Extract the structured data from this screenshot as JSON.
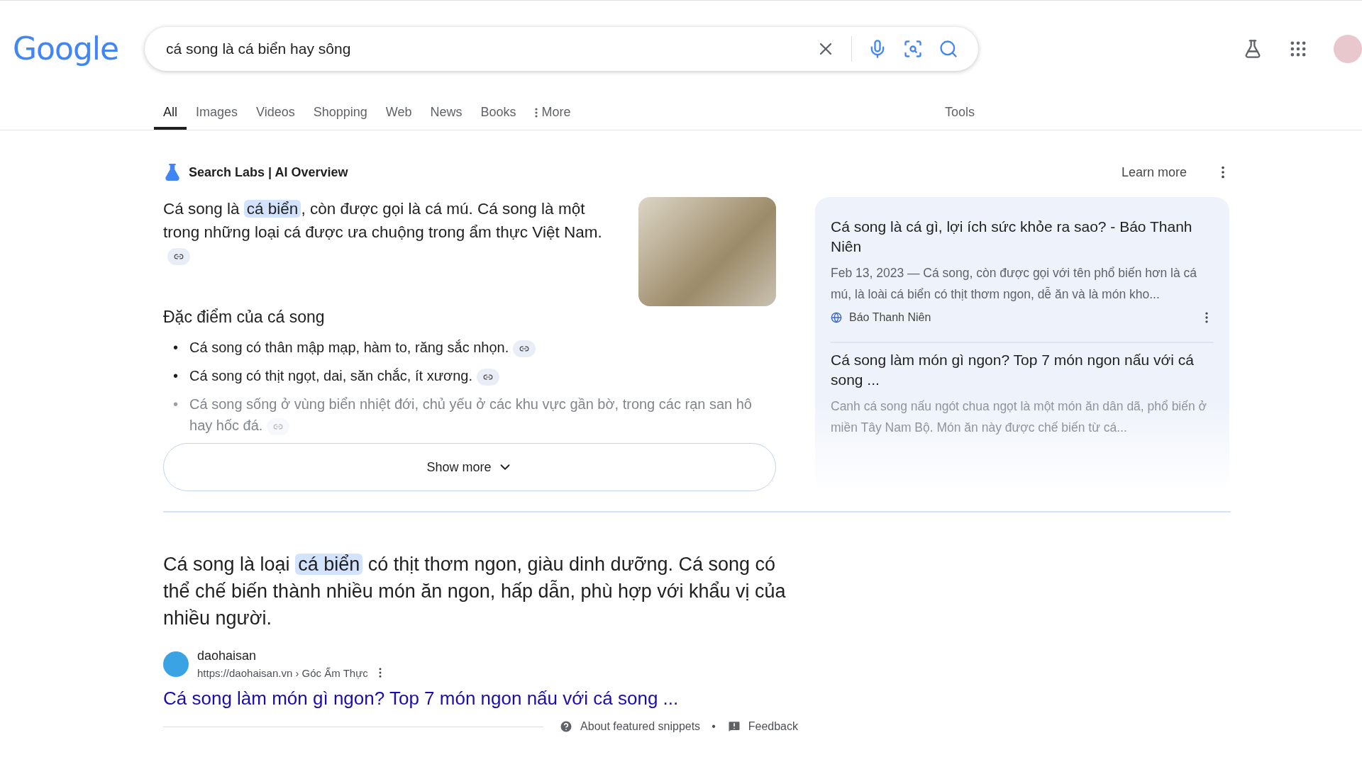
{
  "header": {
    "logo": "Google",
    "query": "cá song là cá biển hay sông"
  },
  "tabs": [
    {
      "label": "All",
      "selected": true
    },
    {
      "label": "Images",
      "selected": false
    },
    {
      "label": "Videos",
      "selected": false
    },
    {
      "label": "Shopping",
      "selected": false
    },
    {
      "label": "Web",
      "selected": false
    },
    {
      "label": "News",
      "selected": false
    },
    {
      "label": "Books",
      "selected": false
    },
    {
      "label": "More",
      "selected": false
    }
  ],
  "tools": "Tools",
  "ai_overview": {
    "title": "Search Labs | AI Overview",
    "learn_more": "Learn more",
    "intro": [
      {
        "text": "Cá song là ",
        "highlight": false
      },
      {
        "text": "cá biển",
        "highlight": true
      },
      {
        "text": ", còn được gọi là cá mú. Cá song là một trong những loại cá được ưa chuộng trong ẩm thực Việt Nam.",
        "highlight": false
      }
    ],
    "heading": "Đặc điểm của cá song",
    "bullets": [
      {
        "marker": "•",
        "text": "Cá song có thân mập mạp, hàm to, răng sắc nhọn.",
        "faded": false
      },
      {
        "marker": "•",
        "text": "Cá song có thịt ngọt, dai, săn chắc, ít xương.",
        "faded": false
      },
      {
        "marker": "•",
        "text": "Cá song sống ở vùng biển nhiệt đới, chủ yếu ở các khu vực gần bờ, trong các rạn san hô hay hốc đá.",
        "faded": true
      }
    ],
    "show_more": "Show more",
    "sources": [
      {
        "title": "Cá song là cá gì, lợi ích sức khỏe ra sao? - Báo Thanh Niên",
        "snippet": "Feb 13, 2023 — Cá song, còn được gọi với tên phổ biến hơn là cá mú, là loài cá biển có thịt thơm ngon, dễ ăn và là món kho...",
        "site": "Báo Thanh Niên",
        "faded": false
      },
      {
        "title": "Cá song làm món gì ngon? Top 7 món ngon nấu với cá song ...",
        "snippet": "Canh cá song nấu ngót chua ngọt là một món ăn dân dã, phổ biến ở miền Tây Nam Bộ. Món ăn này được chế biến từ cá...",
        "faded": true
      }
    ]
  },
  "featured": {
    "text": [
      {
        "text": "Cá song là loại ",
        "highlight": false
      },
      {
        "text": "cá biển",
        "highlight": true
      },
      {
        "text": " có thịt thơm ngon, giàu dinh dưỡng. Cá song có thể chế biến thành nhiều món ăn ngon, hấp dẫn, phù hợp với khẩu vị của nhiều người.",
        "highlight": false
      }
    ],
    "site_name": "daohaisan",
    "breadcrumb": "https://daohaisan.vn › Góc Ẩm Thực",
    "link": "Cá song làm món gì ngon? Top 7 món ngon nấu với cá song ...",
    "about": "About featured snippets",
    "separator": "•",
    "feedback": "Feedback"
  }
}
